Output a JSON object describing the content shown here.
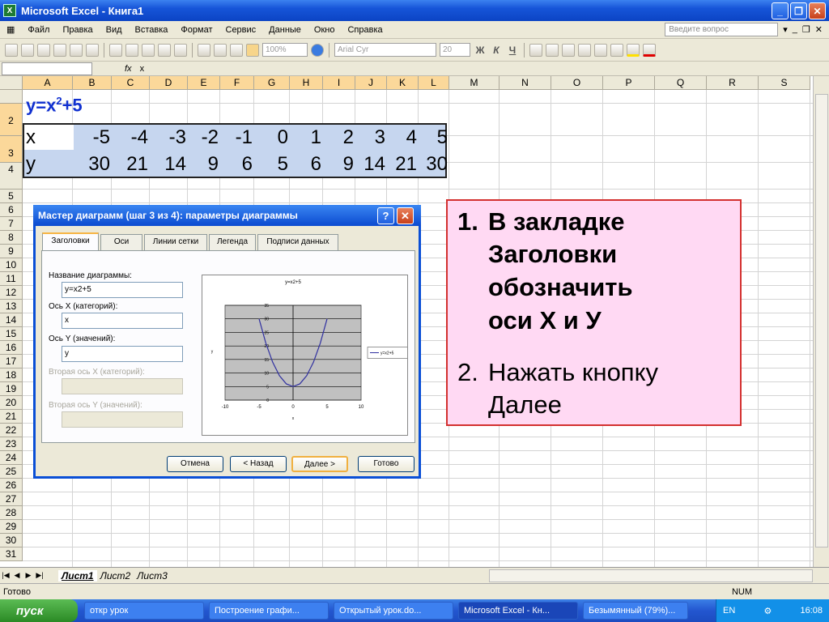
{
  "window": {
    "title": "Microsoft Excel - Книга1",
    "icon": "excel-icon"
  },
  "menu": [
    "Файл",
    "Правка",
    "Вид",
    "Вставка",
    "Формат",
    "Сервис",
    "Данные",
    "Окно",
    "Справка"
  ],
  "ask_placeholder": "Введите вопрос",
  "toolbar": {
    "zoom": "100%",
    "font": "Arial Cyr",
    "size": "20",
    "bold": "Ж",
    "italic": "К",
    "underline": "Ч"
  },
  "formula": {
    "fx": "fx",
    "value": "x"
  },
  "columns": [
    "A",
    "B",
    "C",
    "D",
    "E",
    "F",
    "G",
    "H",
    "I",
    "J",
    "K",
    "L",
    "M",
    "N",
    "O",
    "P",
    "Q",
    "R",
    "S"
  ],
  "rows": [
    "1",
    "2",
    "3",
    "4",
    "5",
    "6",
    "7",
    "8",
    "9",
    "10",
    "11",
    "12",
    "13",
    "14",
    "15",
    "16",
    "17",
    "18",
    "19",
    "20",
    "21",
    "22",
    "23",
    "24",
    "25",
    "26",
    "27",
    "28",
    "29",
    "30",
    "31"
  ],
  "sheet": {
    "title_main": "y=x",
    "title_sup": "2",
    "title_end": "+5",
    "row_x_label": "x",
    "x_values": [
      "-5",
      "-4",
      "-3",
      "-2",
      "-1",
      "0",
      "1",
      "2",
      "3",
      "4",
      "5"
    ],
    "row_y_label": "y",
    "y_values": [
      "30",
      "21",
      "14",
      "9",
      "6",
      "5",
      "6",
      "9",
      "14",
      "21",
      "30"
    ]
  },
  "dialog": {
    "title": "Мастер диаграмм (шаг 3 из 4): параметры диаграммы",
    "help": "?",
    "close": "✕",
    "tabs": [
      "Заголовки",
      "Оси",
      "Линии сетки",
      "Легенда",
      "Подписи данных"
    ],
    "fields": [
      {
        "label": "Название диаграммы:",
        "value": "y=x2+5",
        "enabled": true
      },
      {
        "label": "Ось X (категорий):",
        "value": "x",
        "enabled": true
      },
      {
        "label": "Ось Y (значений):",
        "value": "y",
        "enabled": true
      },
      {
        "label": "Вторая ось X (категорий):",
        "value": "",
        "enabled": false
      },
      {
        "label": "Вторая ось Y (значений):",
        "value": "",
        "enabled": false
      }
    ],
    "buttons": [
      "Отмена",
      "< Назад",
      "Далее >",
      "Готово"
    ]
  },
  "chart_data": {
    "type": "line",
    "title": "y=x2+5",
    "xlabel": "x",
    "ylabel": "y",
    "x": [
      -5,
      -4,
      -3,
      -2,
      -1,
      0,
      1,
      2,
      3,
      4,
      5
    ],
    "series": [
      {
        "name": "y=x2+5",
        "values": [
          30,
          21,
          14,
          9,
          6,
          5,
          6,
          9,
          14,
          21,
          30
        ]
      }
    ],
    "xlim": [
      -10,
      10
    ],
    "ylim": [
      0,
      35
    ],
    "xticks": [
      "-10",
      "-5",
      "0",
      "5",
      "10"
    ],
    "yticks": [
      "0",
      "5",
      "10",
      "15",
      "20",
      "25",
      "30",
      "35"
    ],
    "grid": true,
    "legend": "right",
    "line_color": "#3030a0",
    "plot_bg": "#c0c0c0"
  },
  "note": {
    "item1_num": "1.",
    "item1_l1": "В закладке",
    "item1_l2": "Заголовки",
    "item1_l3": "обозначить",
    "item1_l4": "оси Х и У",
    "item2_num": "2.",
    "item2_l1": "Нажать кнопку",
    "item2_l2": "Далее"
  },
  "sheettabs": [
    "Лист1",
    "Лист2",
    "Лист3"
  ],
  "status": {
    "ready": "Готово",
    "num": "NUM"
  },
  "taskbar": {
    "start": "пуск",
    "tasks": [
      "откр урок",
      "Построение графи...",
      "Открытый урок.do...",
      "Microsoft Excel - Кн...",
      "Безымянный (79%)..."
    ],
    "lang": "EN",
    "time": "16:08"
  }
}
